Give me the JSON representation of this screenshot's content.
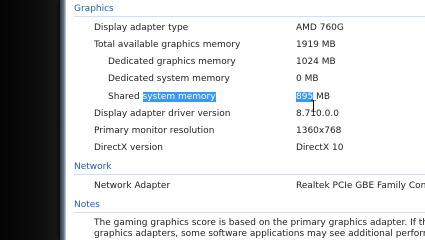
{
  "sections": {
    "graphics": "Graphics",
    "network": "Network",
    "notes": "Notes"
  },
  "graphics": {
    "rows": [
      {
        "label": "Display adapter type",
        "value": "AMD 760G"
      },
      {
        "label": "Total available graphics memory",
        "value": "1919 MB"
      },
      {
        "label": "Dedicated graphics memory",
        "value": "1024 MB"
      },
      {
        "label": "Dedicated system memory",
        "value": "0 MB"
      },
      {
        "label_prefix": "Shared ",
        "label_selected": "system memory",
        "value_selected": "895",
        "value_suffix": " MB"
      },
      {
        "label": "Display adapter driver version",
        "value": "8.710.0.0"
      },
      {
        "label": "Primary monitor resolution",
        "value": "1360x768"
      },
      {
        "label": "DirectX version",
        "value": "DirectX 10"
      }
    ]
  },
  "network": {
    "label": "Network Adapter",
    "value": "Realtek PCIe GBE Family Contro"
  },
  "notes": {
    "line1": "The gaming graphics score is based on the primary graphics adapter. If this system",
    "line2": "graphics adapters, some software applications may see additional performance be"
  }
}
